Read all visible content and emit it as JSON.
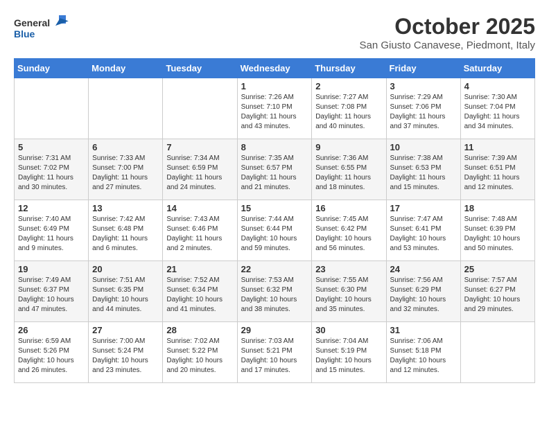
{
  "header": {
    "logo_line1": "General",
    "logo_line2": "Blue",
    "month": "October 2025",
    "location": "San Giusto Canavese, Piedmont, Italy"
  },
  "days_of_week": [
    "Sunday",
    "Monday",
    "Tuesday",
    "Wednesday",
    "Thursday",
    "Friday",
    "Saturday"
  ],
  "weeks": [
    [
      {
        "day": "",
        "info": ""
      },
      {
        "day": "",
        "info": ""
      },
      {
        "day": "",
        "info": ""
      },
      {
        "day": "1",
        "info": "Sunrise: 7:26 AM\nSunset: 7:10 PM\nDaylight: 11 hours and 43 minutes."
      },
      {
        "day": "2",
        "info": "Sunrise: 7:27 AM\nSunset: 7:08 PM\nDaylight: 11 hours and 40 minutes."
      },
      {
        "day": "3",
        "info": "Sunrise: 7:29 AM\nSunset: 7:06 PM\nDaylight: 11 hours and 37 minutes."
      },
      {
        "day": "4",
        "info": "Sunrise: 7:30 AM\nSunset: 7:04 PM\nDaylight: 11 hours and 34 minutes."
      }
    ],
    [
      {
        "day": "5",
        "info": "Sunrise: 7:31 AM\nSunset: 7:02 PM\nDaylight: 11 hours and 30 minutes."
      },
      {
        "day": "6",
        "info": "Sunrise: 7:33 AM\nSunset: 7:00 PM\nDaylight: 11 hours and 27 minutes."
      },
      {
        "day": "7",
        "info": "Sunrise: 7:34 AM\nSunset: 6:59 PM\nDaylight: 11 hours and 24 minutes."
      },
      {
        "day": "8",
        "info": "Sunrise: 7:35 AM\nSunset: 6:57 PM\nDaylight: 11 hours and 21 minutes."
      },
      {
        "day": "9",
        "info": "Sunrise: 7:36 AM\nSunset: 6:55 PM\nDaylight: 11 hours and 18 minutes."
      },
      {
        "day": "10",
        "info": "Sunrise: 7:38 AM\nSunset: 6:53 PM\nDaylight: 11 hours and 15 minutes."
      },
      {
        "day": "11",
        "info": "Sunrise: 7:39 AM\nSunset: 6:51 PM\nDaylight: 11 hours and 12 minutes."
      }
    ],
    [
      {
        "day": "12",
        "info": "Sunrise: 7:40 AM\nSunset: 6:49 PM\nDaylight: 11 hours and 9 minutes."
      },
      {
        "day": "13",
        "info": "Sunrise: 7:42 AM\nSunset: 6:48 PM\nDaylight: 11 hours and 6 minutes."
      },
      {
        "day": "14",
        "info": "Sunrise: 7:43 AM\nSunset: 6:46 PM\nDaylight: 11 hours and 2 minutes."
      },
      {
        "day": "15",
        "info": "Sunrise: 7:44 AM\nSunset: 6:44 PM\nDaylight: 10 hours and 59 minutes."
      },
      {
        "day": "16",
        "info": "Sunrise: 7:45 AM\nSunset: 6:42 PM\nDaylight: 10 hours and 56 minutes."
      },
      {
        "day": "17",
        "info": "Sunrise: 7:47 AM\nSunset: 6:41 PM\nDaylight: 10 hours and 53 minutes."
      },
      {
        "day": "18",
        "info": "Sunrise: 7:48 AM\nSunset: 6:39 PM\nDaylight: 10 hours and 50 minutes."
      }
    ],
    [
      {
        "day": "19",
        "info": "Sunrise: 7:49 AM\nSunset: 6:37 PM\nDaylight: 10 hours and 47 minutes."
      },
      {
        "day": "20",
        "info": "Sunrise: 7:51 AM\nSunset: 6:35 PM\nDaylight: 10 hours and 44 minutes."
      },
      {
        "day": "21",
        "info": "Sunrise: 7:52 AM\nSunset: 6:34 PM\nDaylight: 10 hours and 41 minutes."
      },
      {
        "day": "22",
        "info": "Sunrise: 7:53 AM\nSunset: 6:32 PM\nDaylight: 10 hours and 38 minutes."
      },
      {
        "day": "23",
        "info": "Sunrise: 7:55 AM\nSunset: 6:30 PM\nDaylight: 10 hours and 35 minutes."
      },
      {
        "day": "24",
        "info": "Sunrise: 7:56 AM\nSunset: 6:29 PM\nDaylight: 10 hours and 32 minutes."
      },
      {
        "day": "25",
        "info": "Sunrise: 7:57 AM\nSunset: 6:27 PM\nDaylight: 10 hours and 29 minutes."
      }
    ],
    [
      {
        "day": "26",
        "info": "Sunrise: 6:59 AM\nSunset: 5:26 PM\nDaylight: 10 hours and 26 minutes."
      },
      {
        "day": "27",
        "info": "Sunrise: 7:00 AM\nSunset: 5:24 PM\nDaylight: 10 hours and 23 minutes."
      },
      {
        "day": "28",
        "info": "Sunrise: 7:02 AM\nSunset: 5:22 PM\nDaylight: 10 hours and 20 minutes."
      },
      {
        "day": "29",
        "info": "Sunrise: 7:03 AM\nSunset: 5:21 PM\nDaylight: 10 hours and 17 minutes."
      },
      {
        "day": "30",
        "info": "Sunrise: 7:04 AM\nSunset: 5:19 PM\nDaylight: 10 hours and 15 minutes."
      },
      {
        "day": "31",
        "info": "Sunrise: 7:06 AM\nSunset: 5:18 PM\nDaylight: 10 hours and 12 minutes."
      },
      {
        "day": "",
        "info": ""
      }
    ]
  ]
}
